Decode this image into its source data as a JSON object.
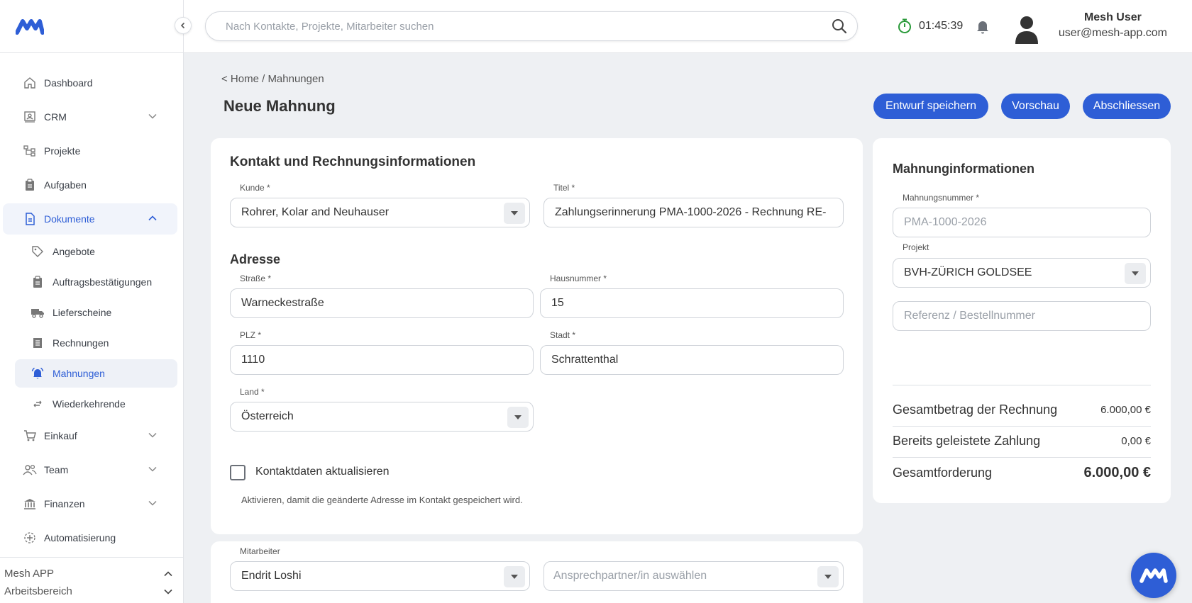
{
  "brand": {
    "accent": "#2e5ed6"
  },
  "search": {
    "placeholder": "Nach Kontakte, Projekte, Mitarbeiter suchen"
  },
  "header": {
    "timer": "01:45:39",
    "user_name": "Mesh User",
    "user_email": "user@mesh-app.com"
  },
  "sidebar": {
    "items": [
      {
        "label": "Dashboard",
        "icon": "home-icon"
      },
      {
        "label": "CRM",
        "icon": "crm-icon"
      },
      {
        "label": "Projekte",
        "icon": "projects-icon"
      },
      {
        "label": "Aufgaben",
        "icon": "clipboard-icon"
      },
      {
        "label": "Dokumente",
        "icon": "document-icon"
      },
      {
        "label": "Einkauf",
        "icon": "cart-icon"
      },
      {
        "label": "Team",
        "icon": "team-icon"
      },
      {
        "label": "Finanzen",
        "icon": "bank-icon"
      },
      {
        "label": "Automatisierung",
        "icon": "automation-icon"
      }
    ],
    "sub_items": [
      {
        "label": "Angebote",
        "icon": "tag-icon"
      },
      {
        "label": "Auftragsbestätigungen",
        "icon": "clipboard-icon"
      },
      {
        "label": "Lieferscheine",
        "icon": "truck-icon"
      },
      {
        "label": "Rechnungen",
        "icon": "invoice-icon"
      },
      {
        "label": "Mahnungen",
        "icon": "alarm-icon"
      },
      {
        "label": "Wiederkehrende",
        "icon": "repeat-icon"
      }
    ],
    "footer": {
      "app": "Mesh APP",
      "workspace": "Arbeitsbereich"
    }
  },
  "page": {
    "breadcrumb": "< Home / Mahnungen",
    "title": "Neue Mahnung",
    "buttons": {
      "draft": "Entwurf speichern",
      "preview": "Vorschau",
      "finish": "Abschliessen"
    }
  },
  "contact": {
    "title": "Kontakt und Rechnungsinformationen",
    "customer_label": "Kunde *",
    "customer": "Rohrer, Kolar and Neuhauser",
    "title_label": "Titel *",
    "title_value": "Zahlungserinnerung PMA-1000-2026 - Rechnung RE-",
    "address_title": "Adresse",
    "street_label": "Straße *",
    "street": "Warneckestraße",
    "house_label": "Hausnummer *",
    "house": "15",
    "zip_label": "PLZ *",
    "zip": "1110",
    "city_label": "Stadt *",
    "city": "Schrattenthal",
    "country_label": "Land *",
    "country": "Österreich",
    "update_label": "Kontaktdaten aktualisieren",
    "update_hint": "Aktivieren, damit die geänderte Adresse im Kontakt gespeichert wird.",
    "employee_label": "Mitarbeiter",
    "employee": "Endrit Loshi",
    "contact_placeholder": "Ansprechpartner/in auswählen"
  },
  "info": {
    "title": "Mahnunginformationen",
    "number_label": "Mahnungsnummer *",
    "number_placeholder": "PMA-1000-2026",
    "project_label": "Projekt",
    "project": "BVH-ZÜRICH GOLDSEE",
    "reference_placeholder": "Referenz / Bestellnummer",
    "total_invoice_label": "Gesamtbetrag der Rechnung",
    "total_invoice": "6.000,00 €",
    "paid_label": "Bereits geleistete Zahlung",
    "paid": "0,00 €",
    "claim_label": "Gesamtforderung",
    "claim": "6.000,00 €"
  }
}
